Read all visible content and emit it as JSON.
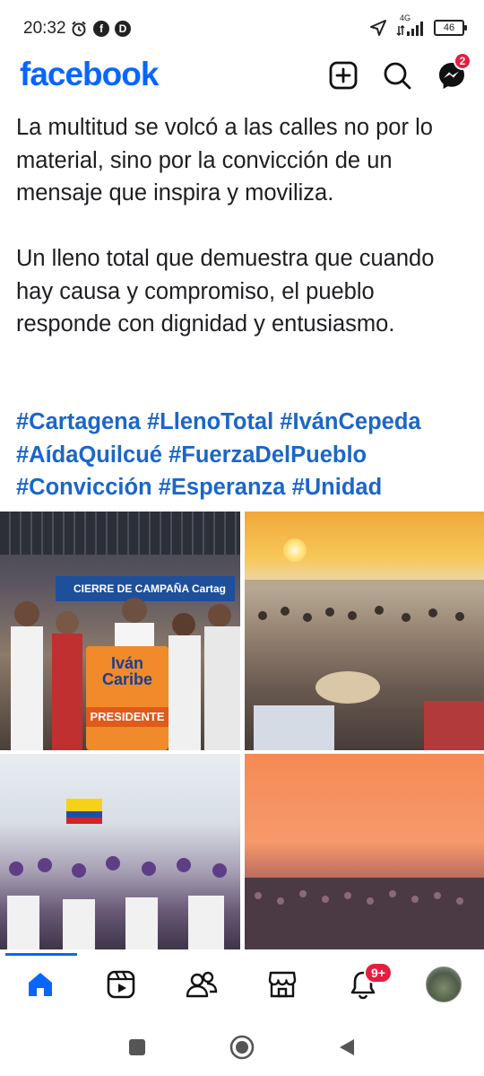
{
  "status_bar": {
    "time": "20:32",
    "network": "4G",
    "battery": "46",
    "icons": [
      "alarm-icon",
      "facebook-notification-icon",
      "app-notification-icon",
      "location-arrow-icon",
      "signal-icon",
      "battery-icon"
    ]
  },
  "header": {
    "logo": "facebook",
    "messenger_badge": "2",
    "actions": [
      "create-icon",
      "search-icon",
      "messenger-icon"
    ]
  },
  "post": {
    "paragraph_1": "La multitud se volcó a las calles no por lo material, sino por la convicción de un mensaje que inspira y moviliza.",
    "paragraph_2": "Un lleno total que demuestra que cuando hay causa y compromiso, el pueblo responde con dignidad y entusiasmo.",
    "hashtags": [
      "#Cartagena",
      "#LlenoTotal",
      "#IvánCepeda",
      "#AídaQuilcué",
      "#FuerzaDelPueblo",
      "#Convicción",
      "#Esperanza",
      "#Unidad"
    ]
  },
  "photos": {
    "photo_1": {
      "banner_text": "CIERRE DE CAMPAÑA  Cartag",
      "podium_line_1": "Iván",
      "podium_line_2": "Caribe",
      "podium_line_3": "PRESIDENTE"
    }
  },
  "bottom_nav": {
    "items": [
      "home-icon",
      "video-icon",
      "friends-icon",
      "marketplace-icon",
      "notifications-icon",
      "profile-avatar"
    ],
    "notifications_badge": "9+"
  },
  "colors": {
    "brand": "#0866ff",
    "hashtag": "#1b66c9",
    "badge": "#e41e3f"
  }
}
